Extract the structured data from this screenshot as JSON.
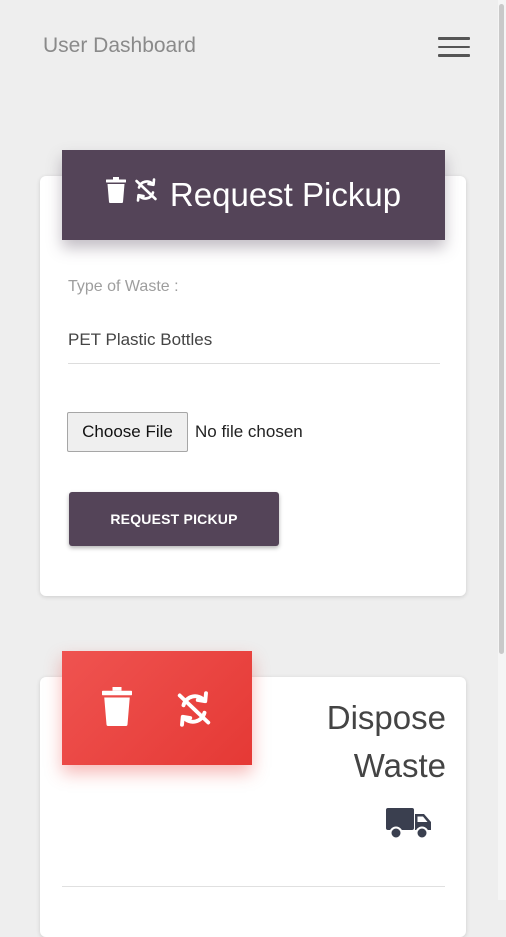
{
  "header": {
    "title": "User Dashboard",
    "menu_icon": "hamburger-menu-icon"
  },
  "request_card": {
    "title": "Request Pickup",
    "icons": [
      "trash-icon",
      "recycle-icon"
    ],
    "header_color": "#544458",
    "field_label": "Type of Waste :",
    "field_value": "PET Plastic Bottles",
    "file_button_label": "Choose File",
    "file_status": "No file chosen",
    "submit_label": "REQUEST PICKUP"
  },
  "dispose_card": {
    "title_line1": "Dispose",
    "title_line2": "Waste",
    "icons": [
      "trash-icon",
      "recycle-icon",
      "truck-icon"
    ],
    "header_color": "#e53935"
  }
}
